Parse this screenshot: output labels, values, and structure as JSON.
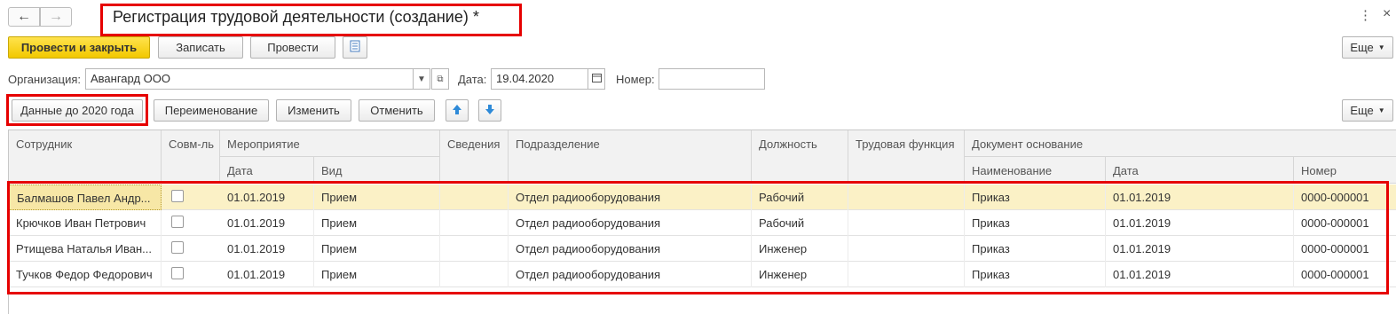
{
  "nav": {
    "back": "←",
    "forward": "→"
  },
  "window": {
    "title": "Регистрация трудовой деятельности (создание) *",
    "menu_icon": "⋮",
    "close_icon": "×"
  },
  "toolbar": {
    "post_close": "Провести и закрыть",
    "save": "Записать",
    "post": "Провести",
    "more": "Еще"
  },
  "form": {
    "org_label": "Организация:",
    "org_value": "Авангард ООО",
    "date_label": "Дата:",
    "date_value": "19.04.2020",
    "number_label": "Номер:",
    "number_value": ""
  },
  "table_toolbar": {
    "data_before_2020": "Данные до 2020 года",
    "rename": "Переименование",
    "change": "Изменить",
    "cancel": "Отменить",
    "more": "Еще"
  },
  "table": {
    "headers": {
      "employee": "Сотрудник",
      "part_time": "Совм-ль",
      "event": "Мероприятие",
      "event_date": "Дата",
      "event_kind": "Вид",
      "info": "Сведения",
      "department": "Подразделение",
      "position": "Должность",
      "labor_function": "Трудовая функция",
      "basis_doc": "Документ основание",
      "doc_name": "Наименование",
      "doc_date": "Дата",
      "doc_number": "Номер"
    },
    "rows": [
      {
        "employee": "Балмашов Павел Андр...",
        "date": "01.01.2019",
        "kind": "Прием",
        "department": "Отдел радиооборудования",
        "position": "Рабочий",
        "doc_name": "Приказ",
        "doc_date": "01.01.2019",
        "doc_number": "0000-000001"
      },
      {
        "employee": "Крючков Иван Петрович",
        "date": "01.01.2019",
        "kind": "Прием",
        "department": "Отдел радиооборудования",
        "position": "Рабочий",
        "doc_name": "Приказ",
        "doc_date": "01.01.2019",
        "doc_number": "0000-000001"
      },
      {
        "employee": "Ртищева Наталья Иван...",
        "date": "01.01.2019",
        "kind": "Прием",
        "department": "Отдел радиооборудования",
        "position": "Инженер",
        "doc_name": "Приказ",
        "doc_date": "01.01.2019",
        "doc_number": "0000-000001"
      },
      {
        "employee": "Тучков Федор Федорович",
        "date": "01.01.2019",
        "kind": "Прием",
        "department": "Отдел радиооборудования",
        "position": "Инженер",
        "doc_name": "Приказ",
        "doc_date": "01.01.2019",
        "doc_number": "0000-000001"
      }
    ]
  },
  "colors": {
    "accent_yellow": "#f2c800",
    "highlight_red": "#e60000",
    "selected_row": "#fbf1c6",
    "arrow_blue": "#2e8ad8"
  }
}
